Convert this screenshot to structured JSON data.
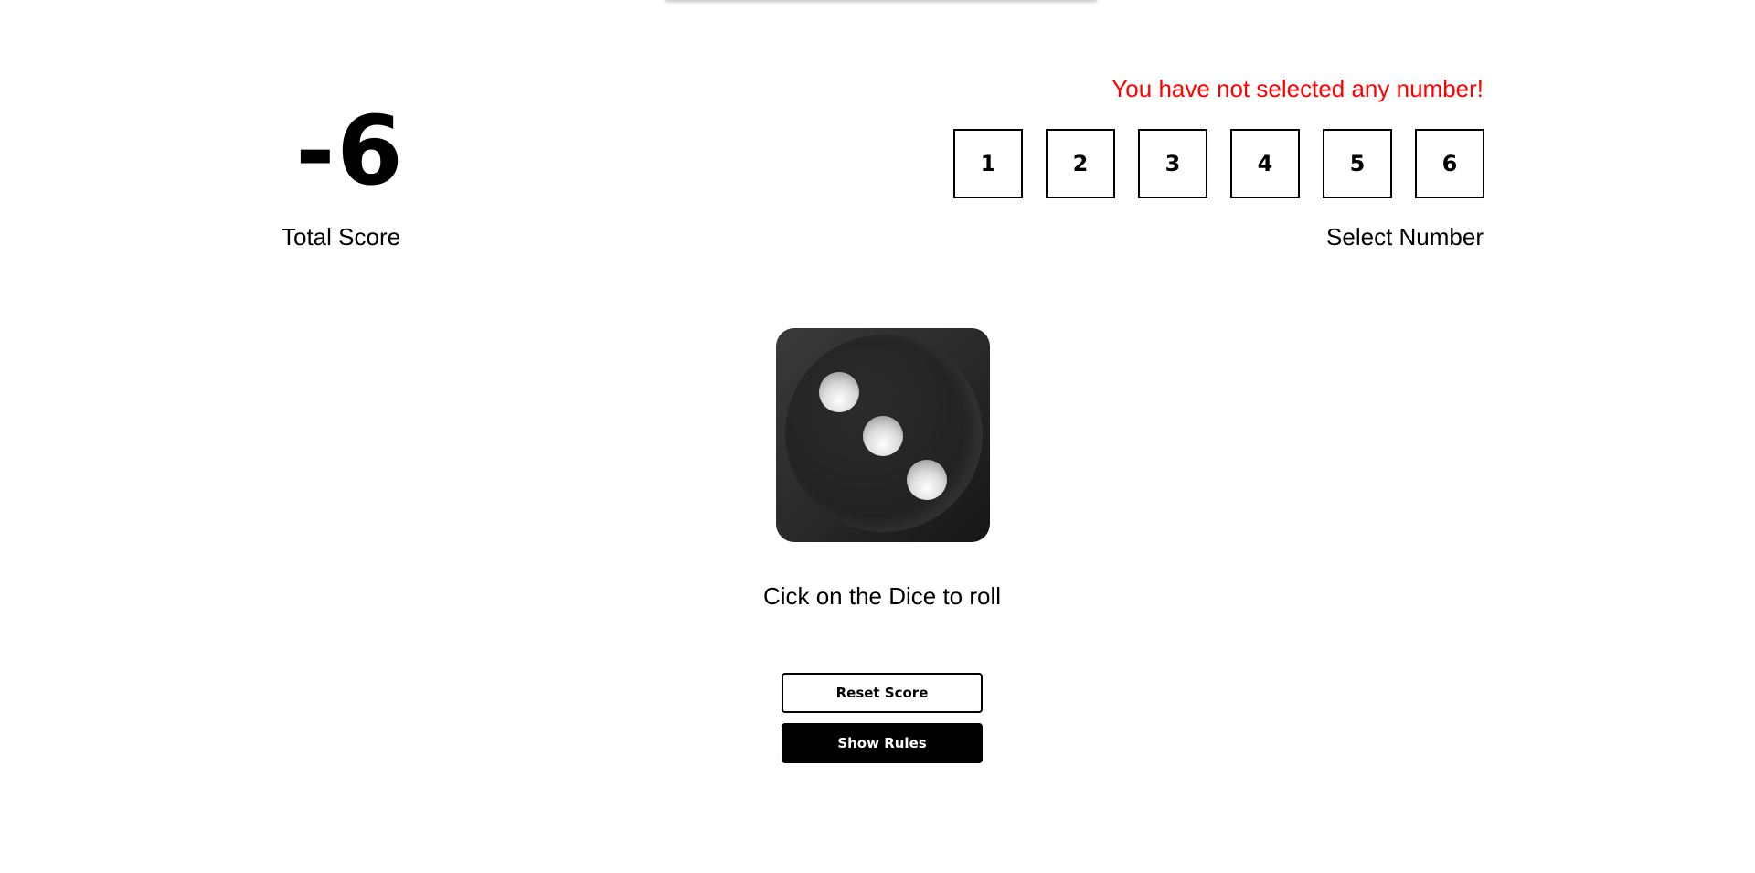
{
  "score": {
    "value": "-6",
    "label": "Total Score"
  },
  "selection": {
    "error_message": "You have not selected any number!",
    "label": "Select Number",
    "numbers": [
      "1",
      "2",
      "3",
      "4",
      "5",
      "6"
    ]
  },
  "dice": {
    "face_value": 3,
    "hint": "Cick on the Dice to roll"
  },
  "buttons": {
    "reset_label": "Reset Score",
    "rules_label": "Show Rules"
  },
  "colors": {
    "error": "#ff0000",
    "primary": "#000000",
    "background": "#ffffff"
  }
}
